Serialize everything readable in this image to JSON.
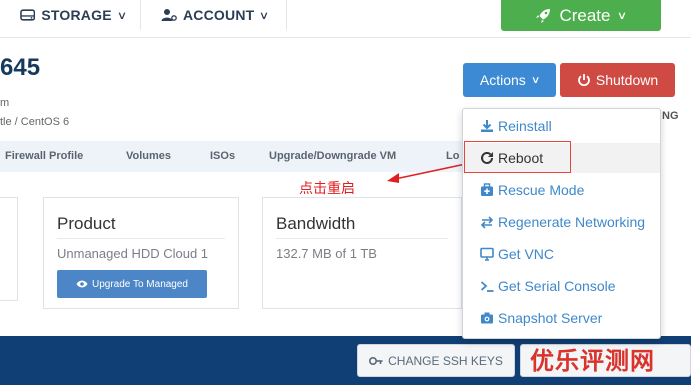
{
  "nav": {
    "storage_label": "STORAGE",
    "account_label": "ACCOUNT",
    "create_label": "Create",
    "create_color": "#4cae4c"
  },
  "server": {
    "id_partial": "645",
    "line1_partial": "m",
    "line2_partial": "tle / CentOS 6"
  },
  "buttons": {
    "actions_label": "Actions",
    "shutdown_label": "Shutdown",
    "actions_color": "#3d8ad4",
    "shutdown_color": "#d04a44"
  },
  "partial_right_text": "NG",
  "tabs": [
    "Firewall Profile",
    "Volumes",
    "ISOs",
    "Upgrade/Downgrade VM",
    "Lo"
  ],
  "annotation": "点击重启",
  "cards": {
    "product": {
      "title": "Product",
      "value": "Unmanaged HDD Cloud 1",
      "button_label": "Upgrade To Managed"
    },
    "bandwidth": {
      "title": "Bandwidth",
      "value": "132.7 MB of 1 TB"
    }
  },
  "actions_menu": {
    "items": [
      {
        "label": "Reinstall",
        "icon": "download-icon"
      },
      {
        "label": "Reboot",
        "icon": "refresh-icon"
      },
      {
        "label": "Rescue Mode",
        "icon": "medkit-icon"
      },
      {
        "label": "Regenerate Networking",
        "icon": "exchange-icon"
      },
      {
        "label": "Get VNC",
        "icon": "desktop-icon"
      },
      {
        "label": "Get Serial Console",
        "icon": "terminal-icon"
      },
      {
        "label": "Snapshot Server",
        "icon": "camera-icon"
      }
    ],
    "highlighted": "Reboot"
  },
  "footer": {
    "ssh_keys_label": "CHANGE SSH KEYS",
    "bar_color": "#0f3f74"
  },
  "watermark": "优乐评测网"
}
